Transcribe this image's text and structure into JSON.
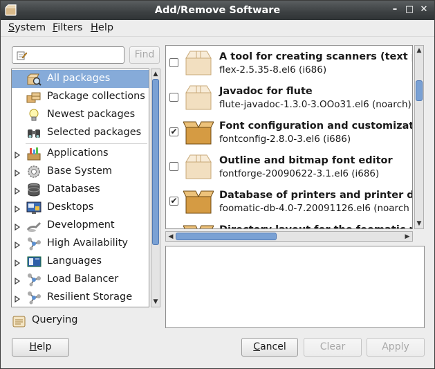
{
  "window": {
    "title": "Add/Remove Software"
  },
  "titlebar_buttons": [
    {
      "name": "minimize",
      "glyph": "–"
    },
    {
      "name": "maximize",
      "glyph": "□"
    },
    {
      "name": "close",
      "glyph": "✕"
    }
  ],
  "menubar": [
    {
      "mnemonic": "S",
      "rest": "ystem"
    },
    {
      "mnemonic": "F",
      "rest": "ilters"
    },
    {
      "mnemonic": "H",
      "rest": "elp"
    }
  ],
  "search": {
    "value": "",
    "find_label": "Find"
  },
  "groups": [
    {
      "label": "All packages",
      "icon": "all-packages-icon",
      "selected": true,
      "expandable": false
    },
    {
      "label": "Package collections",
      "icon": "package-collections-icon",
      "selected": false,
      "expandable": false
    },
    {
      "label": "Newest packages",
      "icon": "lightbulb-icon",
      "selected": false,
      "expandable": false
    },
    {
      "label": "Selected packages",
      "icon": "binoculars-icon",
      "selected": false,
      "expandable": false
    },
    {
      "label": "Applications",
      "icon": "applications-icon",
      "selected": false,
      "expandable": true
    },
    {
      "label": "Base System",
      "icon": "gear-icon",
      "selected": false,
      "expandable": true
    },
    {
      "label": "Databases",
      "icon": "database-icon",
      "selected": false,
      "expandable": true
    },
    {
      "label": "Desktops",
      "icon": "desktop-icon",
      "selected": false,
      "expandable": true
    },
    {
      "label": "Development",
      "icon": "development-icon",
      "selected": false,
      "expandable": true
    },
    {
      "label": "High Availability",
      "icon": "network-icon",
      "selected": false,
      "expandable": true
    },
    {
      "label": "Languages",
      "icon": "flag-icon",
      "selected": false,
      "expandable": true
    },
    {
      "label": "Load Balancer",
      "icon": "network-icon",
      "selected": false,
      "expandable": true
    },
    {
      "label": "Resilient Storage",
      "icon": "network-icon",
      "selected": false,
      "expandable": true
    }
  ],
  "status": {
    "text": "Querying",
    "icon": "querying-icon"
  },
  "packages": [
    {
      "name": "A tool for creating scanners (text pa",
      "version": "flex-2.5.35-8.el6 (i686)",
      "checked": false,
      "installed": false
    },
    {
      "name": "Javadoc for flute",
      "version": "flute-javadoc-1.3.0-3.OOo31.el6 (noarch)",
      "checked": false,
      "installed": false
    },
    {
      "name": "Font configuration and customizatio",
      "version": "fontconfig-2.8.0-3.el6 (i686)",
      "checked": true,
      "installed": true
    },
    {
      "name": "Outline and bitmap font editor",
      "version": "fontforge-20090622-3.1.el6 (i686)",
      "checked": false,
      "installed": false
    },
    {
      "name": "Database of printers and printer driv",
      "version": "foomatic-db-4.0-7.20091126.el6 (noarch",
      "checked": true,
      "installed": true
    },
    {
      "name": "Directory layout for the foomatic pa",
      "version": "",
      "checked": false,
      "installed": true
    }
  ],
  "buttons": {
    "help": {
      "mnemonic": "H",
      "rest": "elp"
    },
    "cancel": {
      "mnemonic": "C",
      "rest": "ancel"
    },
    "clear": {
      "mnemonic": "",
      "rest": "Clear"
    },
    "apply": {
      "mnemonic": "",
      "rest": "Apply"
    }
  },
  "colors": {
    "selection": "#86abd9",
    "titlebar": "#3c4042",
    "scroll_thumb": "#7aa1d4"
  }
}
